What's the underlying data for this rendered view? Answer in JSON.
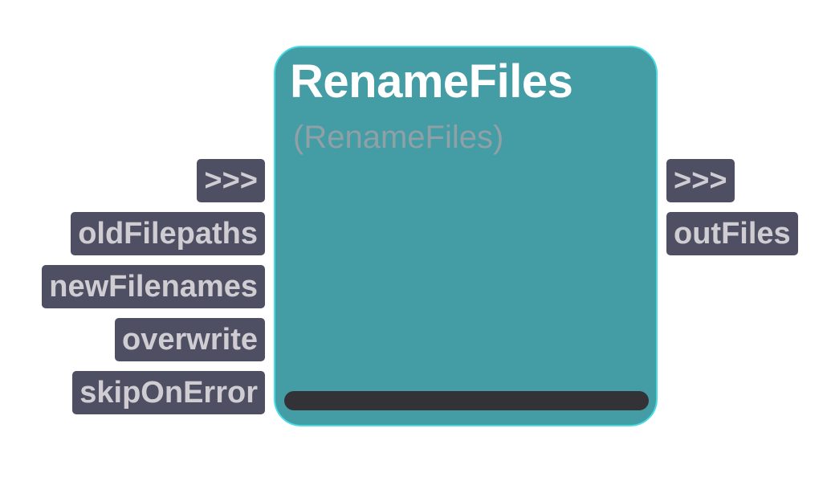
{
  "node": {
    "title": "RenameFiles",
    "subtitle": "(RenameFiles)"
  },
  "inputs": [
    {
      "label": ">>>"
    },
    {
      "label": "oldFilepaths"
    },
    {
      "label": "newFilenames"
    },
    {
      "label": "overwrite"
    },
    {
      "label": "skipOnError"
    }
  ],
  "outputs": [
    {
      "label": ">>>"
    },
    {
      "label": "outFiles"
    }
  ],
  "colors": {
    "node_fill": "#449ca4",
    "node_border": "#47dbe6",
    "port_fill": "#4f4f64",
    "port_text": "#cfcdd2",
    "bar": "#333236"
  }
}
